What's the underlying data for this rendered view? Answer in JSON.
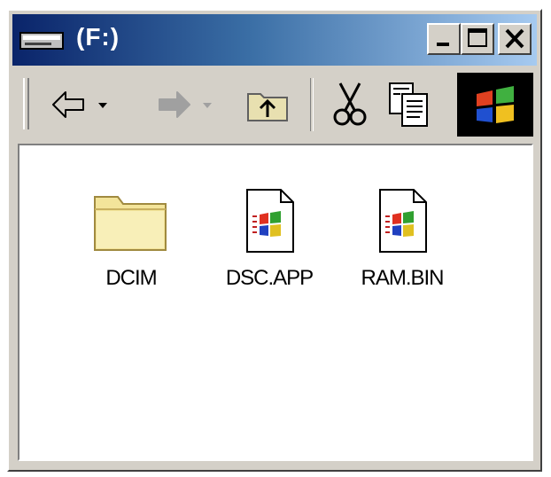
{
  "window": {
    "title": "(F:)",
    "title_icon": "drive-icon",
    "controls": [
      "minimize-icon",
      "maximize-icon",
      "close-icon"
    ]
  },
  "toolbar": {
    "items": [
      "back-arrow-icon",
      "back-dropdown-icon",
      "forward-arrow-icon",
      "forward-dropdown-icon",
      "up-folder-icon",
      "cut-icon",
      "copy-icon"
    ],
    "throbber_icon": "windows-logo-icon"
  },
  "files": [
    {
      "name": "DCIM",
      "icon": "folder-icon"
    },
    {
      "name": "DSC.APP",
      "icon": "windows-app-file-icon"
    },
    {
      "name": "RAM.BIN",
      "icon": "windows-app-file-icon"
    }
  ],
  "colors": {
    "title_gradient_start": "#0a246a",
    "title_gradient_end": "#a6caf0",
    "chrome": "#d4d0c8",
    "folder": "#f7e8a0"
  }
}
